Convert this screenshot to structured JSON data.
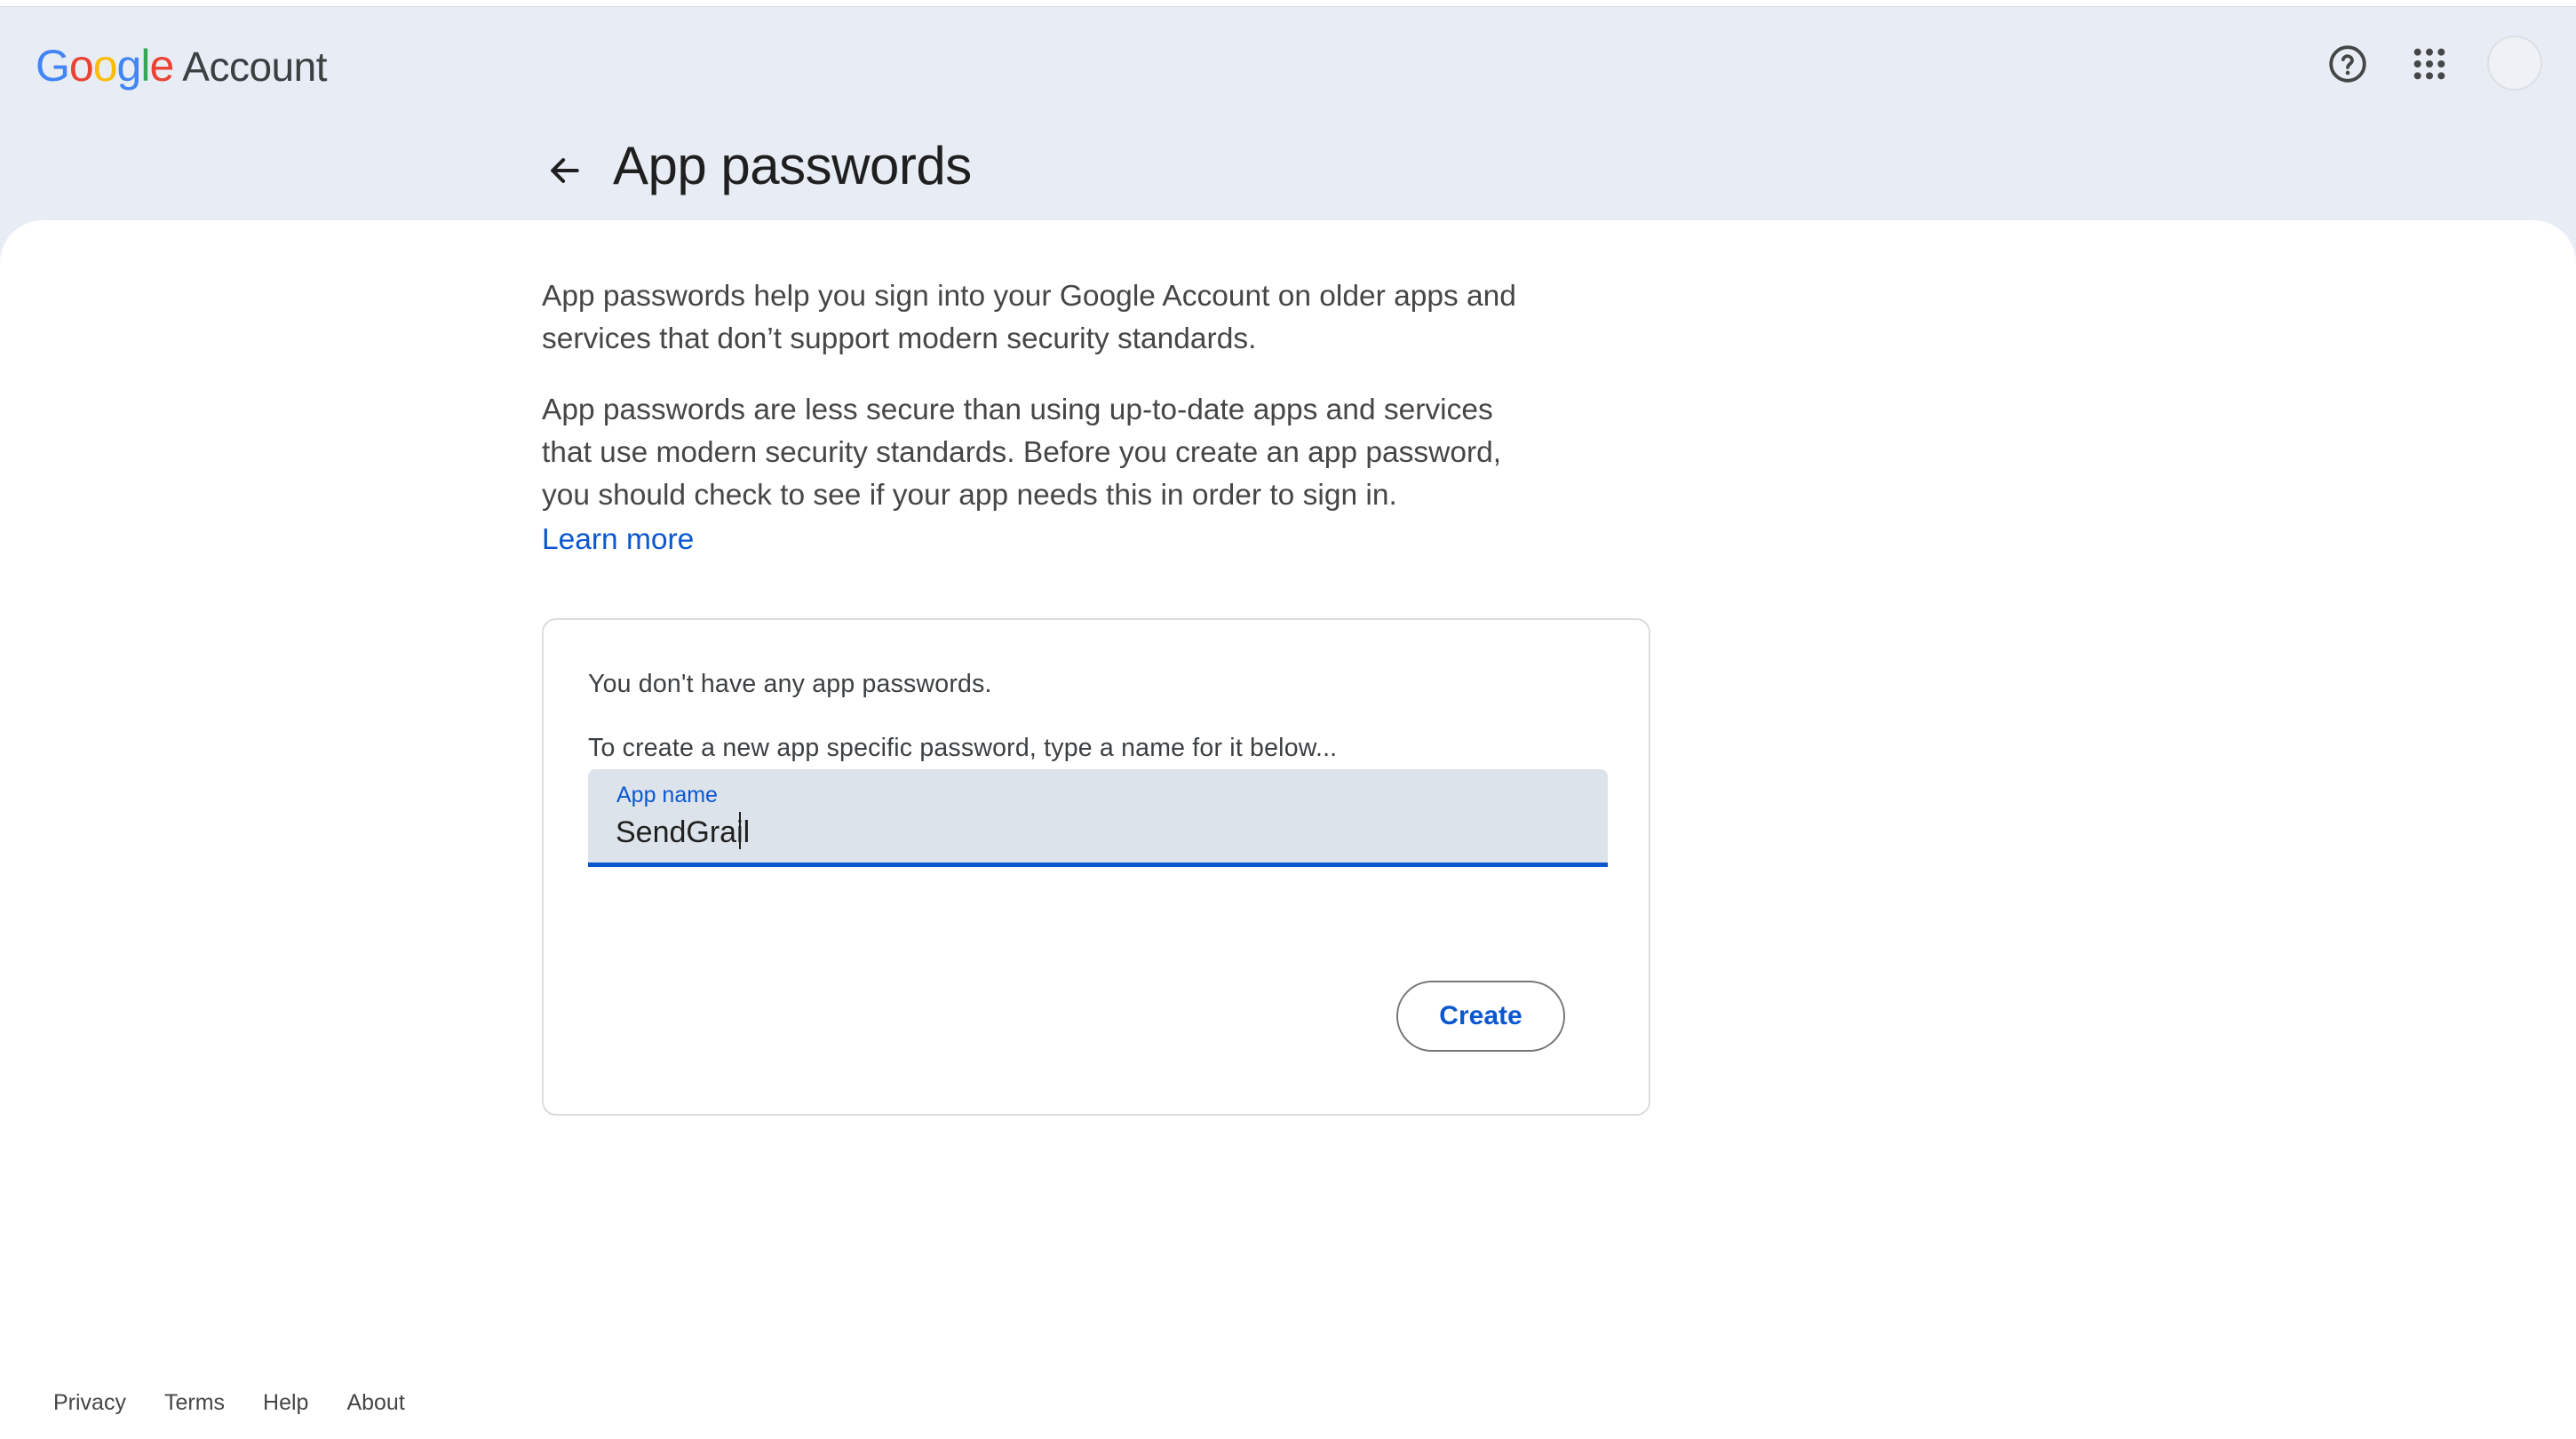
{
  "header": {
    "logo_google": "Google",
    "logo_account": "Account",
    "help_icon": "help-circle-icon",
    "apps_icon": "apps-grid-icon",
    "avatar_icon": "avatar"
  },
  "page": {
    "title": "App passwords",
    "back_icon": "arrow-back-icon"
  },
  "intro": {
    "para1": "App passwords help you sign into your Google Account on older apps and services that don’t support modern security standards.",
    "para2": "App passwords are less secure than using up-to-date apps and services that use modern security standards. Before you create an app password, you should check to see if your app needs this in order to sign in.",
    "learn_more": "Learn more"
  },
  "card": {
    "empty_message": "You don't have any app passwords.",
    "instruction": "To create a new app specific password, type a name for it below...",
    "field_label": "App name",
    "field_value": "SendGrail",
    "create_label": "Create"
  },
  "footer": {
    "links": [
      "Privacy",
      "Terms",
      "Help",
      "About"
    ]
  },
  "colors": {
    "accent": "#0b57d0",
    "header_bg": "#e8ecf4",
    "field_bg": "#dde3ea"
  }
}
